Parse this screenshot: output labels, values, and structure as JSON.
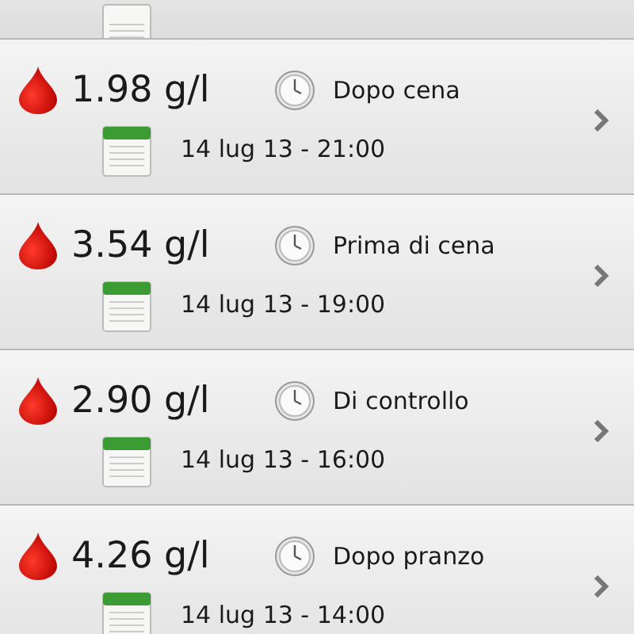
{
  "readings": [
    {
      "value": "1.98 g/l",
      "meal": "Dopo cena",
      "date": "14 lug 13 - 21:00"
    },
    {
      "value": "3.54 g/l",
      "meal": "Prima di cena",
      "date": "14 lug 13 - 19:00"
    },
    {
      "value": "2.90 g/l",
      "meal": "Di controllo",
      "date": "14 lug 13 - 16:00"
    },
    {
      "value": "4.26 g/l",
      "meal": "Dopo pranzo",
      "date": "14 lug 13 - 14:00"
    }
  ]
}
